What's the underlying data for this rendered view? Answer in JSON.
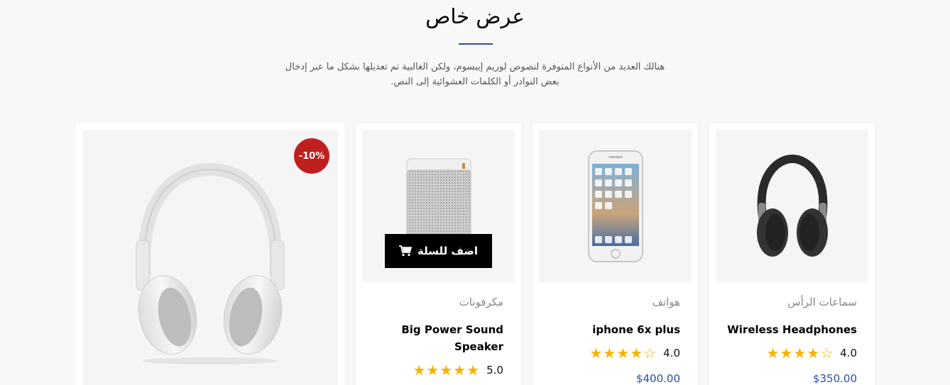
{
  "section": {
    "title": "عرض خاص",
    "description": "هنالك العديد من الأنواع المتوفرة لنصوص لوريم إيبسوم، ولكن الغالبية تم تعديلها بشكل ما عبر إدخال بعض النوادر أو الكلمات العشوائية إلى النص."
  },
  "featured": {
    "discount": "-10%"
  },
  "products": [
    {
      "category": "مكرفونات",
      "name": "Big Power Sound Speaker",
      "rating_value": "5.0",
      "rating": 5,
      "add_to_cart": "اضف للسلة"
    },
    {
      "category": "هواتف",
      "name": "iphone 6x plus",
      "rating_value": "4.0",
      "rating": 4,
      "price": "$400.00"
    },
    {
      "category": "سماعات الرأس",
      "name": "Wireless Headphones",
      "rating_value": "4.0",
      "rating": 4,
      "price": "$350.00"
    }
  ],
  "colors": {
    "accent": "#2d4fa3",
    "discount": "#c01f1f",
    "star": "#f5b301"
  }
}
